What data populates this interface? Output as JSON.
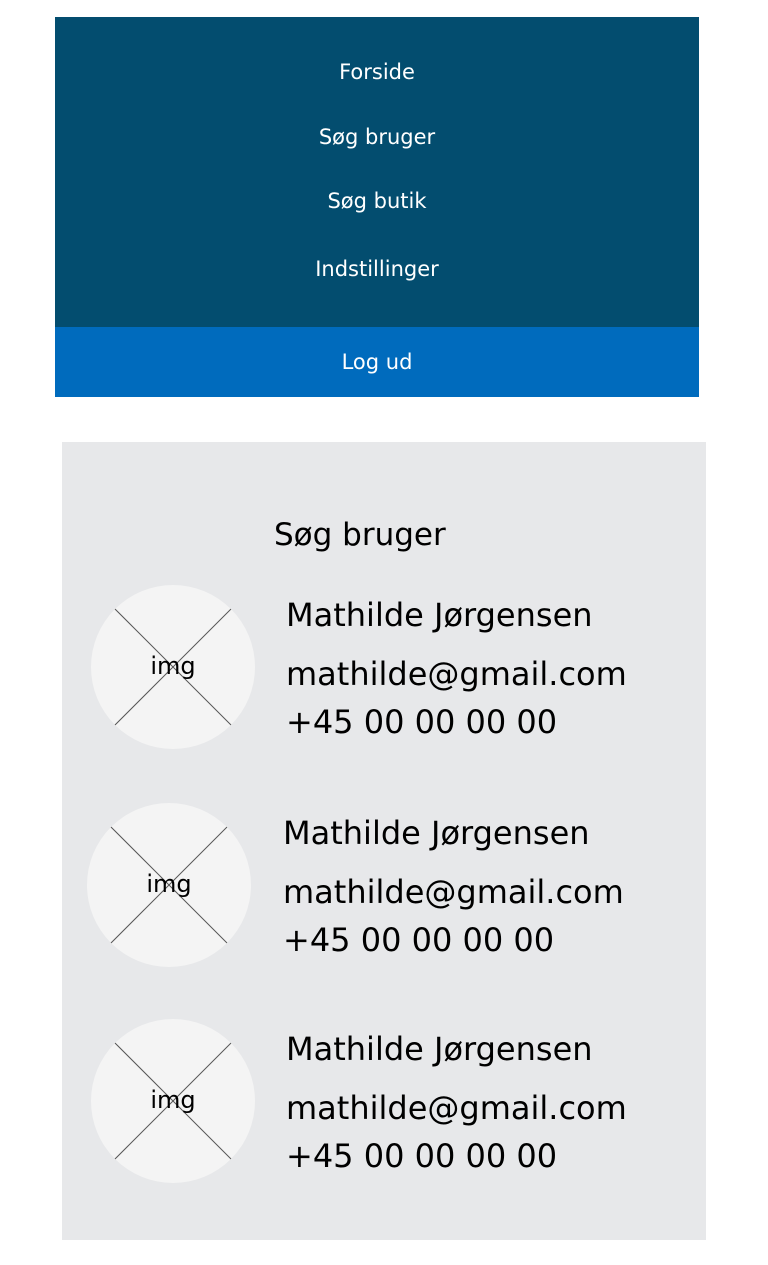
{
  "nav": {
    "items": [
      {
        "label": "Forside"
      },
      {
        "label": "Søg bruger"
      },
      {
        "label": "Søg butik"
      },
      {
        "label": "Indstillinger"
      }
    ],
    "logout_label": "Log ud",
    "colors": {
      "menu_background": "#034d6f",
      "logout_background": "#006bbd",
      "text": "#ffffff"
    }
  },
  "search": {
    "title": "Søg bruger",
    "background": "#e7e8ea",
    "users": [
      {
        "avatar_label": "img",
        "name": "Mathilde Jørgensen",
        "email": "mathilde@gmail.com",
        "phone": "+45 00 00 00 00"
      },
      {
        "avatar_label": "img",
        "name": "Mathilde Jørgensen",
        "email": "mathilde@gmail.com",
        "phone": "+45 00 00 00 00"
      },
      {
        "avatar_label": "img",
        "name": "Mathilde Jørgensen",
        "email": "mathilde@gmail.com",
        "phone": "+45 00 00 00 00"
      }
    ]
  }
}
